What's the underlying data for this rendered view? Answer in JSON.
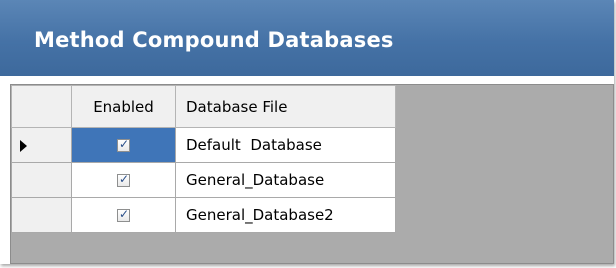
{
  "header": {
    "title": "Method Compound Databases"
  },
  "grid": {
    "columns": {
      "enabled": "Enabled",
      "database_file": "Database File"
    },
    "rows": [
      {
        "enabled": true,
        "database_file": "Default  Database",
        "current": true
      },
      {
        "enabled": true,
        "database_file": "General_Database",
        "current": false
      },
      {
        "enabled": true,
        "database_file": "General_Database2",
        "current": false
      }
    ]
  },
  "colors": {
    "header_blue": "#4572a6",
    "selection_blue": "#3f75b8",
    "grid_background": "#ababab"
  },
  "icons": {
    "current_row": "row-indicator-arrow-icon",
    "checked": "checkbox-checked-icon"
  }
}
